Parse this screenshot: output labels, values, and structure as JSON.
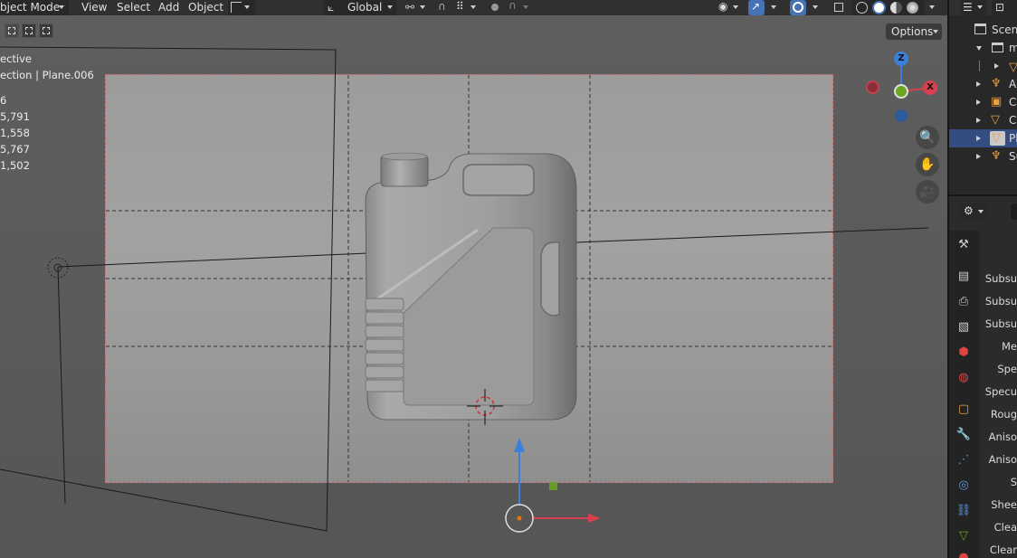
{
  "header": {
    "mode": "bject Mode",
    "menus": [
      "View",
      "Select",
      "Add",
      "Object"
    ],
    "transform_orientation": "Global"
  },
  "options_label": "Options",
  "overlay_info": {
    "view": "ective",
    "collection": "ection | Plane.006",
    "stats": [
      "6",
      "5,791",
      "1,558",
      "5,767",
      "1,502"
    ]
  },
  "gizmo": {
    "z": "Z",
    "x": "X"
  },
  "outliner": {
    "scene_label": "Scene",
    "rows": [
      {
        "label": "m",
        "expanded": true,
        "selected": false
      },
      {
        "label": "",
        "expanded": false,
        "selected": false
      },
      {
        "label": "Ar",
        "expanded": false,
        "selected": false
      },
      {
        "label": "Ca",
        "expanded": false,
        "selected": false
      },
      {
        "label": "Cy",
        "expanded": false,
        "selected": false
      },
      {
        "label": "Pl",
        "expanded": false,
        "selected": true
      },
      {
        "label": "Su",
        "expanded": false,
        "selected": false
      }
    ]
  },
  "properties": {
    "labels": [
      "Subsu",
      "Subsu",
      "Subsu",
      "Me",
      "Spe",
      "Specu",
      "Roug",
      "Aniso",
      "Aniso",
      "S",
      "Shee",
      "Clea",
      "Clear"
    ]
  },
  "colors": {
    "selection_blue": "#334d80",
    "axis_x": "#d9404f",
    "axis_y": "#6aa61f",
    "axis_z": "#3b7fd9",
    "camera_border": "#c46a6a"
  }
}
